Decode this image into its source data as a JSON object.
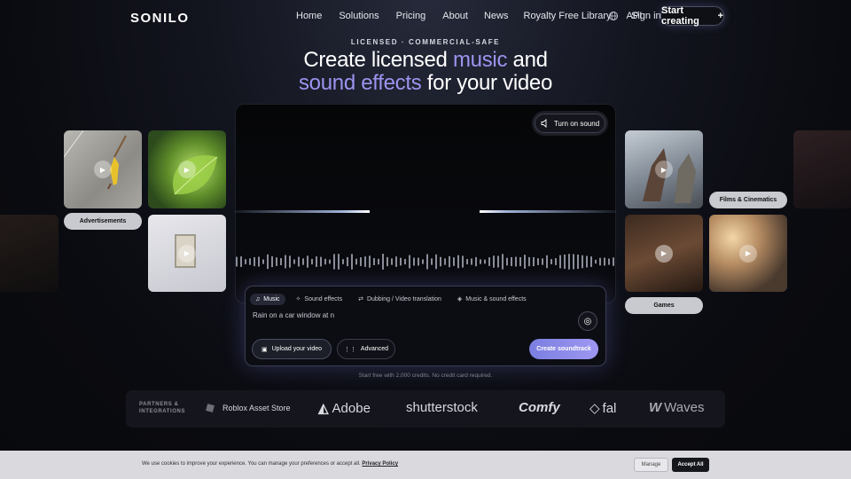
{
  "brand": "SONILO",
  "nav": {
    "items": [
      "Home",
      "Solutions",
      "Pricing",
      "About",
      "News",
      "Royalty Free Library",
      "API"
    ],
    "sign_in": "Sign in",
    "start_creating": "Start creating",
    "start_icon": "+"
  },
  "hero": {
    "eyebrow": "LICENSED · COMMERCIAL-SAFE",
    "line1_pre": "Create licensed ",
    "line1_accent": "music",
    "line1_post": " and",
    "line2_accent": "sound effects",
    "line2_post": " for your video",
    "accent_color": "#9b94f0"
  },
  "tiles": {
    "labels": {
      "advertisements": "Advertisements",
      "films": "Films & Cinematics",
      "games": "Games"
    }
  },
  "video": {
    "sound_button": "Turn on sound"
  },
  "prompt_card": {
    "tabs": [
      "Music",
      "Sound effects",
      "Dubbing / Video translation",
      "Music & sound effects"
    ],
    "active_tab": "Music",
    "prompt_text": "Rain on a car window at n",
    "upload_label": "Upload your video",
    "advanced_label": "Advanced",
    "create_label": "Create soundtrack"
  },
  "free_note": "Start free with 2,000 credits. No credit card required.",
  "partners": {
    "label_line1": "PARTNERS &",
    "label_line2": "INTEGRATIONS",
    "logos": [
      "Roblox Asset Store",
      "Adobe",
      "shutterstock",
      "Comfy",
      "fal",
      "Waves"
    ]
  },
  "cookie": {
    "text": "We use cookies to improve your experience. You can manage your preferences or accept all.",
    "policy_link": "Privacy Policy",
    "manage": "Manage",
    "accept": "Accept All"
  }
}
